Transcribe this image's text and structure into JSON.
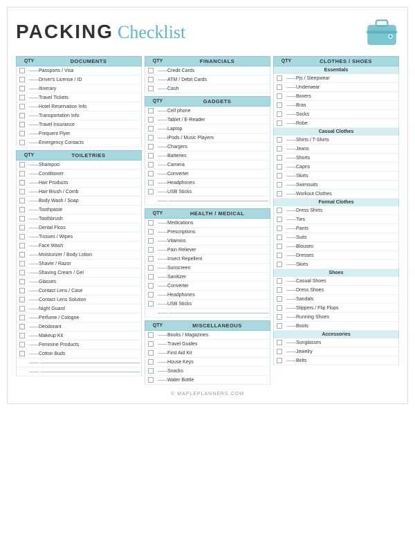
{
  "header": {
    "packing": "PACKING",
    "checklist": "Checklist",
    "footer": "© MAPLEPLANNERS.COM"
  },
  "col1": {
    "sections": [
      {
        "qty": "QTY",
        "title": "DOCUMENTS",
        "items": [
          "Passports / Visa",
          "Driver's License / ID",
          "Itinerary",
          "Travel Tickets",
          "Hotel Reservation Info",
          "Transportation Info",
          "Travel Insurance",
          "Frequent Flyer",
          "Emergency Contacts"
        ]
      },
      {
        "qty": "QTY",
        "title": "TOILETRIES",
        "items": [
          "Shampoo",
          "Conditioner",
          "Hair Products",
          "Hair Brush / Comb",
          "Body Wash / Soap",
          "Toothpaste",
          "Toothbrush",
          "Dental Floss",
          "Tissues / Wipes",
          "Face Wash",
          "Moisturizer / Body Lotion",
          "Shaver / Razor",
          "Shaving Cream / Gel",
          "Glasses",
          "Contact Lens / Case",
          "Contact Lens Solution",
          "Night Guard",
          "Perfume / Cologne",
          "Deodorant",
          "Makeup Kit",
          "Feminine Products",
          "Cotton Buds"
        ],
        "blanks": 2
      }
    ]
  },
  "col2": {
    "sections": [
      {
        "qty": "QTY",
        "title": "FINANCIALS",
        "items": [
          "Credit Cards",
          "ATM / Debit Cards",
          "Cash"
        ]
      },
      {
        "qty": "QTY",
        "title": "GADGETS",
        "items": [
          "Cell phone",
          "Tablet / E-Reader",
          "Laptop",
          "iPods / Music Players",
          "Chargers",
          "Batteries",
          "Camera",
          "Converter",
          "Headphones",
          "USB Sticks"
        ],
        "blanks": 1
      },
      {
        "qty": "QTY",
        "title": "HEALTH / MEDICAL",
        "items": [
          "Medications",
          "Prescriptions",
          "Vitamins",
          "Pain Reliever",
          "Insect Repellent",
          "Sunscreen",
          "Sanitizer",
          "Converter",
          "Headphones",
          "USB Sticks"
        ],
        "blanks": 1
      },
      {
        "qty": "QTY",
        "title": "MISCELLANEOUS",
        "items": [
          "Books / Magazines",
          "Travel Guides",
          "First Aid Kit",
          "House Keys",
          "Snacks",
          "Water Bottle"
        ]
      }
    ]
  },
  "col3": {
    "title_qty": "QTY",
    "title": "CLOTHES / SHOES",
    "sub_sections": [
      {
        "sub_title": "Essentials",
        "items": [
          "Pjs / Sleepwear",
          "Underwear",
          "Boxers",
          "Bras",
          "Socks",
          "Robe"
        ]
      },
      {
        "sub_title": "Casual Clothes",
        "items": [
          "Shirts / T-Shirts",
          "Jeans",
          "Shorts",
          "Capris",
          "Skirts",
          "Swimsuits",
          "Workout Clothes"
        ]
      },
      {
        "sub_title": "Formal Clothes",
        "items": [
          "Dress Shirts",
          "Ties",
          "Pants",
          "Suits",
          "Blouses",
          "Dresses",
          "Skirts"
        ]
      },
      {
        "sub_title": "Shoes",
        "items": [
          "Casual Shoes",
          "Dress Shoes",
          "Sandals",
          "Slippers / Flip Flops",
          "Running Shoes",
          "Boots"
        ]
      },
      {
        "sub_title": "Accessories",
        "items": [
          "Sunglasses",
          "Jewelry",
          "Belts"
        ]
      }
    ]
  }
}
